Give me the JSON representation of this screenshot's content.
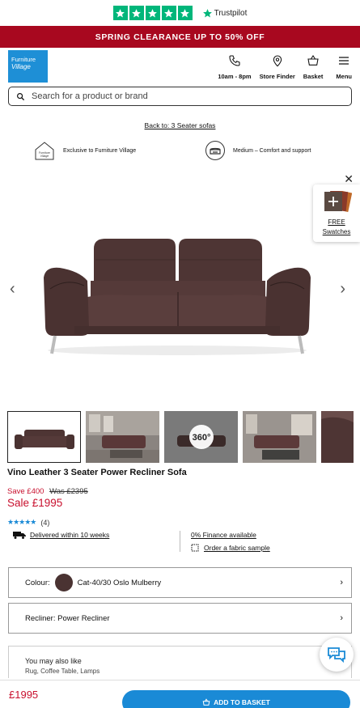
{
  "trustpilot": {
    "label": "Trustpilot",
    "rating_stars": 5
  },
  "promo": {
    "text": "SPRING CLEARANCE UP TO 50% OFF"
  },
  "header": {
    "logo_line1": "Furniture",
    "logo_line2": "Village",
    "nav": [
      {
        "label": "10am - 8pm",
        "icon": "phone-icon"
      },
      {
        "label": "Store Finder",
        "icon": "location-pin-icon"
      },
      {
        "label": "Basket",
        "icon": "basket-icon"
      },
      {
        "label": "Menu",
        "icon": "hamburger-icon"
      }
    ]
  },
  "search": {
    "placeholder": "Search for a product or brand"
  },
  "breadcrumb": {
    "back_link": "Back to: 3 Seater sofas"
  },
  "features": [
    {
      "label": "Exclusive to Furniture Village",
      "icon": "house-icon"
    },
    {
      "label": "Medium – Comfort and support",
      "icon": "seat-comfort-icon"
    }
  ],
  "swatch_card": {
    "line1": "FREE",
    "line2": "Swatches"
  },
  "thumbnails": [
    {
      "label": "sofa-front"
    },
    {
      "label": "sofa-room-1"
    },
    {
      "label": "360"
    },
    {
      "label": "sofa-room-2"
    },
    {
      "label": "sofa-detail"
    }
  ],
  "product": {
    "title": "Vino Leather 3 Seater Power Recliner Sofa",
    "save": "Save £400",
    "was": "Was £2395",
    "price": "Sale £1995",
    "rating_value": 5,
    "review_count": "(4)",
    "delivery": "Delivered within 10 weeks",
    "finance": "0% Finance available",
    "sample": "Order a fabric sample"
  },
  "options": {
    "colour_label": "Colour:",
    "colour_value": "Cat-40/30 Oslo Mulberry",
    "colour_hex": "#4a3332",
    "recliner_label": "Recliner: Power Recliner"
  },
  "also_like": {
    "title": "You may also like",
    "subtitle": "Rug, Coffee Table, Lamps"
  },
  "footer": {
    "price": "£1995",
    "button_label": "ADD TO BASKET"
  },
  "colors": {
    "promo_bg": "#a8081f",
    "accent_blue": "#1a8ad6",
    "sale_red": "#c8102e",
    "trustpilot_green": "#00b67a"
  }
}
